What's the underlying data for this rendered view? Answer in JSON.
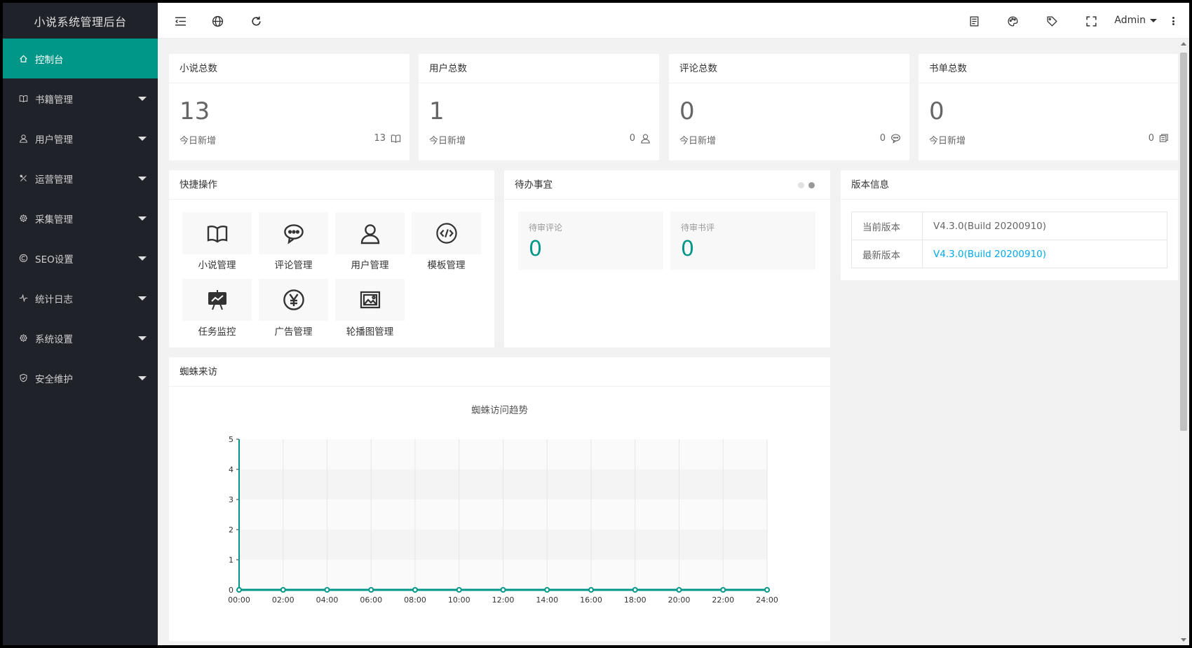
{
  "app": {
    "title": "小说系统管理后台"
  },
  "sidebar": {
    "items": [
      {
        "label": "控制台",
        "icon": "home-icon",
        "active": true,
        "expandable": false
      },
      {
        "label": "书籍管理",
        "icon": "book-icon",
        "expandable": true
      },
      {
        "label": "用户管理",
        "icon": "user-icon",
        "expandable": true
      },
      {
        "label": "运营管理",
        "icon": "tools-icon",
        "expandable": true
      },
      {
        "label": "采集管理",
        "icon": "gear-icon",
        "expandable": true
      },
      {
        "label": "SEO设置",
        "icon": "seo-icon",
        "expandable": true
      },
      {
        "label": "统计日志",
        "icon": "pulse-icon",
        "expandable": true
      },
      {
        "label": "系统设置",
        "icon": "gear-icon",
        "expandable": true
      },
      {
        "label": "安全维护",
        "icon": "shield-icon",
        "expandable": true
      }
    ]
  },
  "header": {
    "user_label": "Admin",
    "left_icons": [
      "menu-toggle-icon",
      "globe-icon",
      "refresh-icon"
    ],
    "right_icons": [
      "note-icon",
      "theme-icon",
      "tag-icon",
      "fullscreen-icon"
    ]
  },
  "stats": [
    {
      "title": "小说总数",
      "value": "13",
      "sub_label": "今日新增",
      "sub_value": "13",
      "icon": "book-icon"
    },
    {
      "title": "用户总数",
      "value": "1",
      "sub_label": "今日新增",
      "sub_value": "0",
      "icon": "user-icon"
    },
    {
      "title": "评论总数",
      "value": "0",
      "sub_label": "今日新增",
      "sub_value": "0",
      "icon": "comment-icon"
    },
    {
      "title": "书单总数",
      "value": "0",
      "sub_label": "今日新增",
      "sub_value": "0",
      "icon": "booklist-icon"
    }
  ],
  "quick_ops": {
    "title": "快捷操作",
    "items": [
      {
        "label": "小说管理",
        "icon": "book-icon"
      },
      {
        "label": "评论管理",
        "icon": "comment-icon"
      },
      {
        "label": "用户管理",
        "icon": "user-icon"
      },
      {
        "label": "模板管理",
        "icon": "code-icon"
      },
      {
        "label": "任务监控",
        "icon": "monitor-icon"
      },
      {
        "label": "广告管理",
        "icon": "yen-icon"
      },
      {
        "label": "轮播图管理",
        "icon": "image-icon"
      }
    ]
  },
  "todo": {
    "title": "待办事宜",
    "items": [
      {
        "label": "待审评论",
        "value": "0"
      },
      {
        "label": "待审书评",
        "value": "0"
      }
    ]
  },
  "version": {
    "title": "版本信息",
    "rows": [
      {
        "key": "当前版本",
        "value": "V4.3.0(Build 20200910)",
        "is_link": false
      },
      {
        "key": "最新版本",
        "value": "V4.3.0(Build 20200910)",
        "is_link": true
      }
    ]
  },
  "spider": {
    "title": "蜘蛛来访"
  },
  "colors": {
    "sidebar_bg": "#20222a",
    "accent": "#009688",
    "link": "#01aaed"
  },
  "chart_data": {
    "type": "line",
    "title": "蜘蛛访问趋势",
    "x": [
      "00:00",
      "02:00",
      "04:00",
      "06:00",
      "08:00",
      "10:00",
      "12:00",
      "14:00",
      "16:00",
      "18:00",
      "20:00",
      "22:00",
      "24:00"
    ],
    "series": [
      {
        "values": [
          0,
          0,
          0,
          0,
          0,
          0,
          0,
          0,
          0,
          0,
          0,
          0,
          0
        ]
      }
    ],
    "ylim": [
      0,
      5
    ],
    "yticks": [
      0,
      1,
      2,
      3,
      4,
      5
    ],
    "grid": true,
    "color": "#009688"
  }
}
